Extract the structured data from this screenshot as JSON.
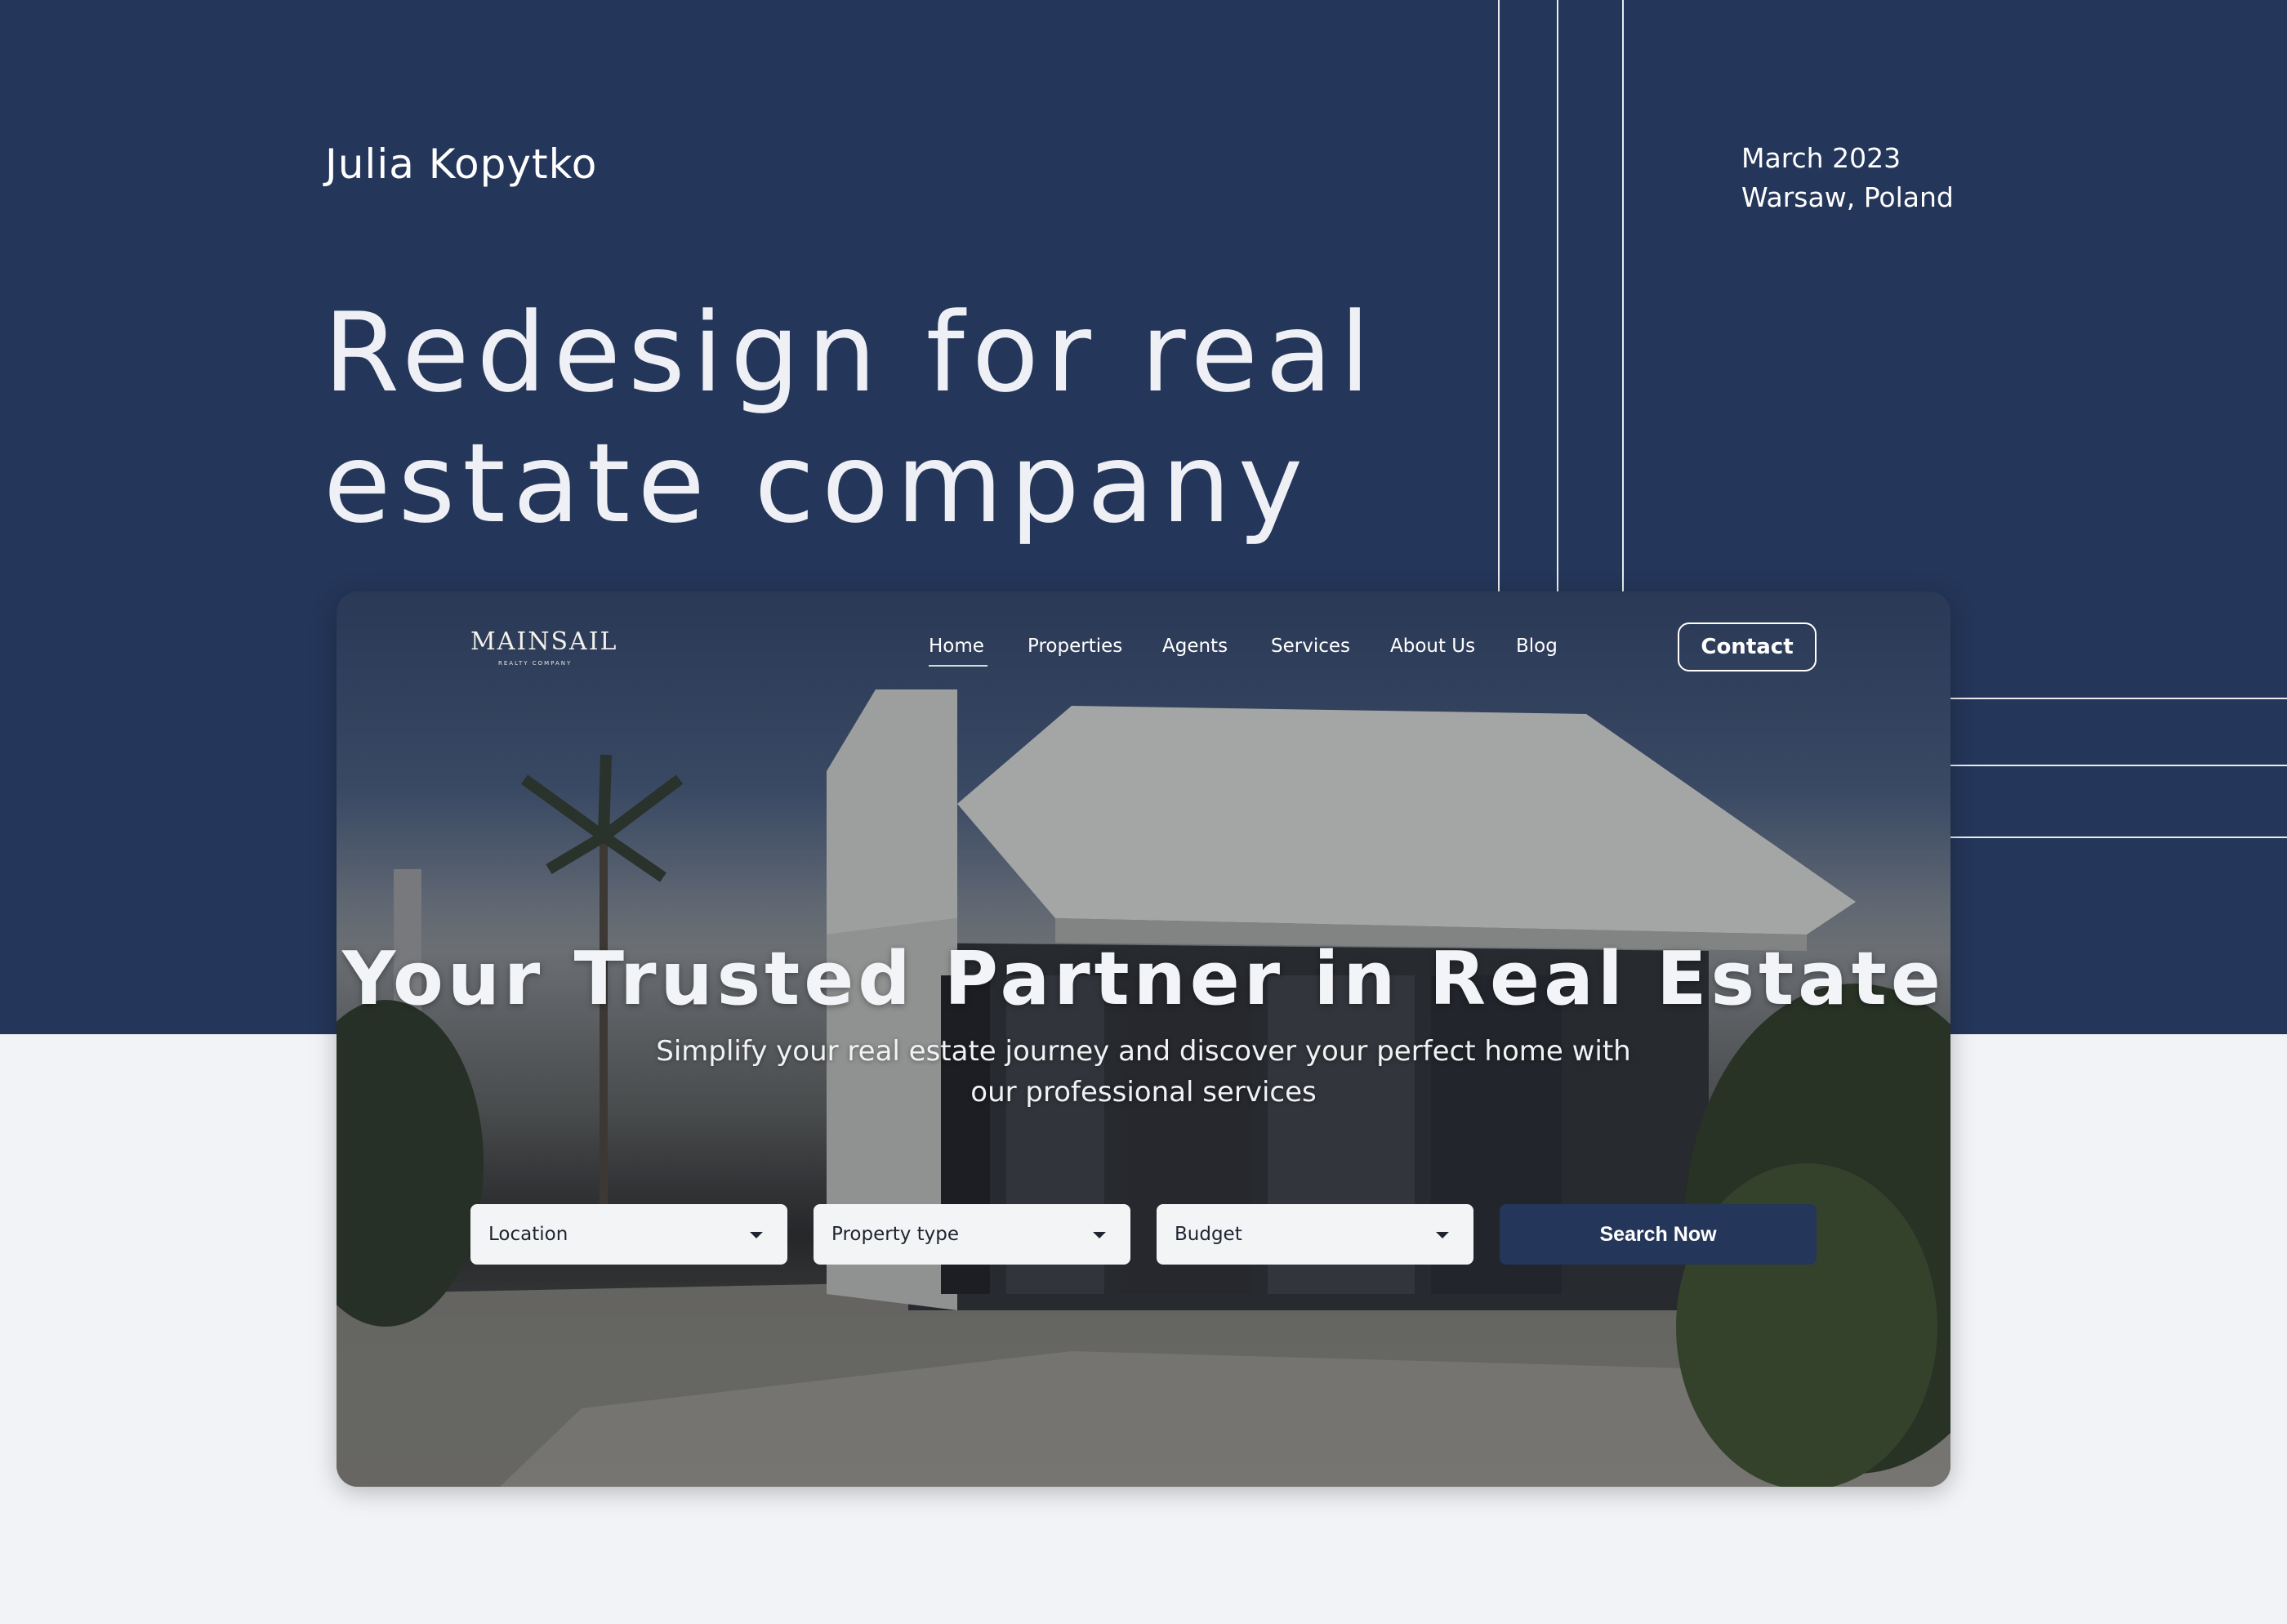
{
  "header": {
    "author": "Julia Kopytko",
    "date": "March 2023",
    "location": "Warsaw, Poland",
    "headline_line1": "Redesign for real",
    "headline_line2": "estate company"
  },
  "site": {
    "logo": "MAINSAIL",
    "logo_tagline": "REALTY COMPANY",
    "nav": [
      "Home",
      "Properties",
      "Agents",
      "Services",
      "About Us",
      "Blog"
    ],
    "active_nav": "Home",
    "contact_label": "Contact",
    "hero_title": "Your Trusted Partner in Real Estate",
    "hero_subtitle_line1": "Simplify your real estate journey and discover your perfect home with",
    "hero_subtitle_line2": "our professional services",
    "filters": [
      {
        "label": "Location",
        "icon": "chevron-down-icon"
      },
      {
        "label": "Property type",
        "icon": "chevron-down-icon"
      },
      {
        "label": "Budget",
        "icon": "chevron-down-icon"
      }
    ],
    "search_label": "Search Now"
  },
  "colors": {
    "navy": "#243659",
    "page_bg": "#f2f3f6",
    "white": "#ffffff"
  }
}
